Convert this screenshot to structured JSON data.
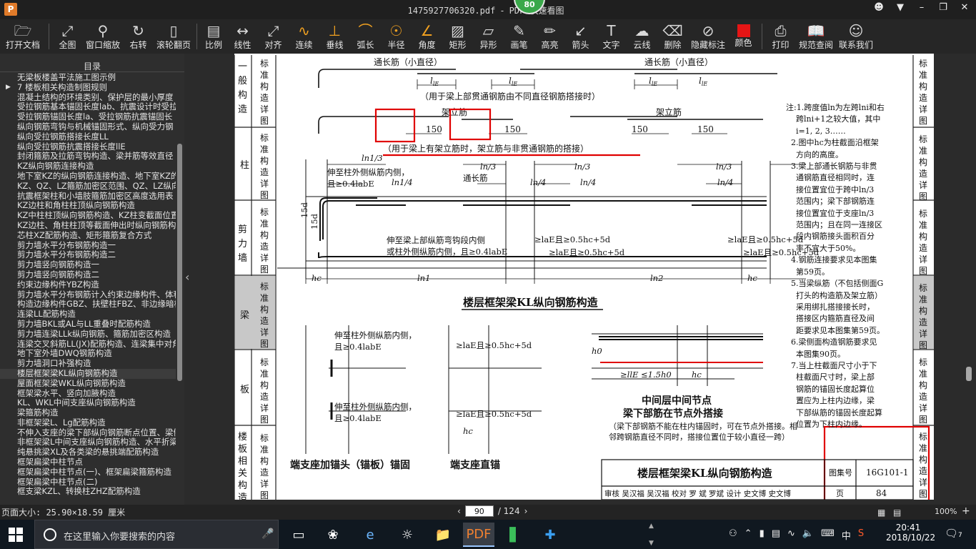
{
  "window": {
    "app_logo": "P",
    "filename": "1475927706320.pdf",
    "separator": "-",
    "app_name": "PDF 快速看图",
    "badge": "80"
  },
  "toolbar": {
    "items": [
      {
        "label": "打开文档",
        "icon": "folder-icon"
      },
      {
        "label": "全图",
        "icon": "fullview-icon"
      },
      {
        "label": "窗口缩放",
        "icon": "zoom-window-icon"
      },
      {
        "label": "右转",
        "icon": "rotate-right-icon"
      },
      {
        "label": "滚轮翻页",
        "icon": "mouse-wheel-icon"
      },
      {
        "label": "比例",
        "icon": "scale-icon"
      },
      {
        "label": "线性",
        "icon": "linear-measure-icon"
      },
      {
        "label": "对齐",
        "icon": "align-measure-icon"
      },
      {
        "label": "连续",
        "icon": "continuous-measure-icon"
      },
      {
        "label": "垂线",
        "icon": "perpendicular-icon"
      },
      {
        "label": "弧长",
        "icon": "arc-length-icon"
      },
      {
        "label": "半径",
        "icon": "radius-icon"
      },
      {
        "label": "角度",
        "icon": "angle-icon"
      },
      {
        "label": "矩形",
        "icon": "rectangle-area-icon"
      },
      {
        "label": "异形",
        "icon": "irregular-area-icon"
      },
      {
        "label": "画笔",
        "icon": "pen-icon"
      },
      {
        "label": "高亮",
        "icon": "highlighter-icon"
      },
      {
        "label": "箭头",
        "icon": "arrow-icon"
      },
      {
        "label": "文字",
        "icon": "text-icon"
      },
      {
        "label": "云线",
        "icon": "cloud-line-icon"
      },
      {
        "label": "删除",
        "icon": "eraser-icon"
      },
      {
        "label": "隐藏标注",
        "icon": "hide-annotation-icon"
      },
      {
        "label": "颜色",
        "icon": "color-icon"
      },
      {
        "label": "打印",
        "icon": "print-icon"
      },
      {
        "label": "规范查阅",
        "icon": "code-book-icon"
      },
      {
        "label": "联系我们",
        "icon": "contact-icon"
      }
    ],
    "color_value": "#e51515"
  },
  "sidebar": {
    "title": "目录",
    "items": [
      "无梁板楼盖平法施工图示例",
      "7 楼板相关构造制图规则",
      "混凝土结构的环境类别、保护层的最小厚度",
      "受拉钢筋基本锚固长度lab、抗震设计时受拉",
      "受拉钢筋锚固长度la、受拉钢筋抗震锚固长",
      "纵向钢筋弯钩与机械锚固形式、纵向受力钢",
      "纵向受拉钢筋搭接长度LL",
      "纵向受拉钢筋抗震搭接长度llE",
      "封闭箍筋及拉筋弯钩构造、梁并筋等效直径",
      "KZ纵向钢筋连接构造",
      "地下室KZ的纵向钢筋连接构造、地下室KZ的箍",
      "KZ、QZ、LZ箍筋加密区范围、QZ、LZ纵向钢筋",
      "抗震框架柱和小墙肢箍筋加密区高度选用表",
      "KZ边柱和角柱柱顶纵向钢筋构造",
      "KZ中柱柱顶纵向钢筋构造、KZ柱变截面位置纵",
      "KZ边柱、角柱柱顶等截面伸出时纵向钢筋构造",
      "芯柱XZ配筋构造、矩形箍筋复合方式",
      "剪力墙水平分布钢筋构造一",
      "剪力墙水平分布钢筋构造二",
      "剪力墙竖向钢筋构造一",
      "剪力墙竖向钢筋构造二",
      "约束边缘构件YBZ构造",
      "剪力墙水平分布钢筋计入约束边缘构件、体积",
      "构造边缘构件GBZ、扶壁柱FBZ、非边缘暗柱AZ",
      "连梁LL配筋构造",
      "剪力墙BKL或AL与LL重叠时配筋构造",
      "剪力墙连梁LLk纵向钢筋、箍筋加密区构造",
      "连梁交叉斜筋LL(JX)配筋构造、连梁集中对角",
      "地下室外墙DWQ钢筋构造",
      "剪力墙洞口补强构造",
      "楼层框架梁KL纵向钢筋构造",
      "屋面框架梁WKL纵向钢筋构造",
      "框架梁水平、竖向加腋构造",
      "KL、WKL中间支座纵向钢筋构造",
      "梁箍筋构造",
      "非框架梁L、Lg配筋构造",
      "不伸入支座的梁下部纵向钢筋断点位置、梁侧",
      "非框架梁L中间支座纵向钢筋构造、水平折梁",
      "纯悬挑梁XL及各类梁的悬挑端配筋构造",
      "框架扁梁中柱节点",
      "框架扁梁中柱节点(一)、框架扁梁箍筋构造",
      "框架扁梁中柱节点(二)",
      "框支梁KZL、转换柱ZHZ配筋构造"
    ],
    "selected_index": 30,
    "expand_index": 1
  },
  "drawing": {
    "side_tabs": [
      "一般构造",
      "柱",
      "剪力墙",
      "梁",
      "板",
      "楼板相关构造"
    ],
    "side_tab_heading": "标准构造详图",
    "upper_label_1": "通长筋（小直径）",
    "upper_caption": "（用于梁上部贯通钢筋由不同直径钢筋搭接时）",
    "llE_label": "l",
    "llE_sub": "lE",
    "jialijin": "架立筋",
    "dim_150": "150",
    "middle_caption": "（用于梁上有架立筋时，架立筋与非贯通钢筋的搭接）",
    "ln1_3": "ln1/3",
    "ln_3": "ln/3",
    "ln_4": "ln/4",
    "ln1_4": "ln1/4",
    "tongchang": "通长筋",
    "left_note_1": "伸至柱外侧纵筋内侧，",
    "left_note_2": "且≥0.4labE",
    "note_bottom_1": "伸至梁上部纵筋弯钩段内侧",
    "note_bottom_2": "或柱外侧纵筋内侧，且≥0.4labE",
    "anchor_1": "≥laE且≥0.5hc+5d",
    "dim_15d": "15d",
    "hc": "hc",
    "ln1": "ln1",
    "ln2": "ln2",
    "main_caption": "楼层框架梁KL纵向钢筋构造",
    "sub_caption_1": "端支座加锚头（锚板）锚固",
    "sub_caption_2": "端支座直锚",
    "sub_caption_3a": "中间层中间节点",
    "sub_caption_3b": "梁下部筋在节点外搭接",
    "sub3_note": "（梁下部钢筋不能在柱内锚固时，可在节点外搭接。相邻跨钢筋直径不同时，搭接位置位于较小直径一跨）",
    "h0": "h0",
    "lle_15h0": "≥llE  ≤1.5h0",
    "hc_label": "hc",
    "notes": [
      "注:1.跨度值ln为左跨lni和右",
      "    跨lni+1之较大值，其中",
      "    i=1, 2, 3……",
      "  2.图中hc为柱截面沿框架",
      "    方向的高度。",
      "  3.梁上部通长钢筋与非贯",
      "    通钢筋直径相同时，连",
      "    接位置宜位于跨中ln/3",
      "    范围内；梁下部钢筋连",
      "    接位置宜位于支座ln/3",
      "    范围内；且在同一连接区",
      "    段内钢筋接头面积百分",
      "    率不宜大于50%。",
      "  4.钢筋连接要求见本图集",
      "    第59页。",
      "  5.当梁纵筋（不包括侧面G",
      "    打头的构造筋及架立筋）",
      "    采用绑扎搭接接长时，",
      "    搭接区内箍筋直径及间",
      "    距要求见本图集第59页。",
      "  6.梁侧面构造钢筋要求见",
      "    本图集90页。",
      "  7.当上柱截面尺寸小于下",
      "    柱截面尺寸时，梁上部",
      "    钢筋的锚固长度起算位",
      "    置应为上柱内边缘，梁",
      "    下部纵筋的锚固长度起算",
      "    位置为下柱内边缘。"
    ],
    "titleblock": {
      "title": "楼层框架梁KL纵向钢筋构造",
      "atlas_label": "图集号",
      "atlas_no": "16G101-1",
      "page_label": "页",
      "page_no": "84",
      "signoff": "审核 吴汉福  吴汉福  校对 罗  斌  罗斌  设计 史文博  史文博"
    },
    "annotation_color": "#e00000"
  },
  "statusbar": {
    "page_size": "页面大小: 25.90×18.59 厘米",
    "current_page": "90",
    "total_pages": "/ 124",
    "zoom": "100%"
  },
  "taskbar": {
    "search_placeholder": "在这里输入你要搜索的内容",
    "ime": "中",
    "time": "20:41",
    "date": "2018/10/22",
    "notification_count": "7"
  }
}
